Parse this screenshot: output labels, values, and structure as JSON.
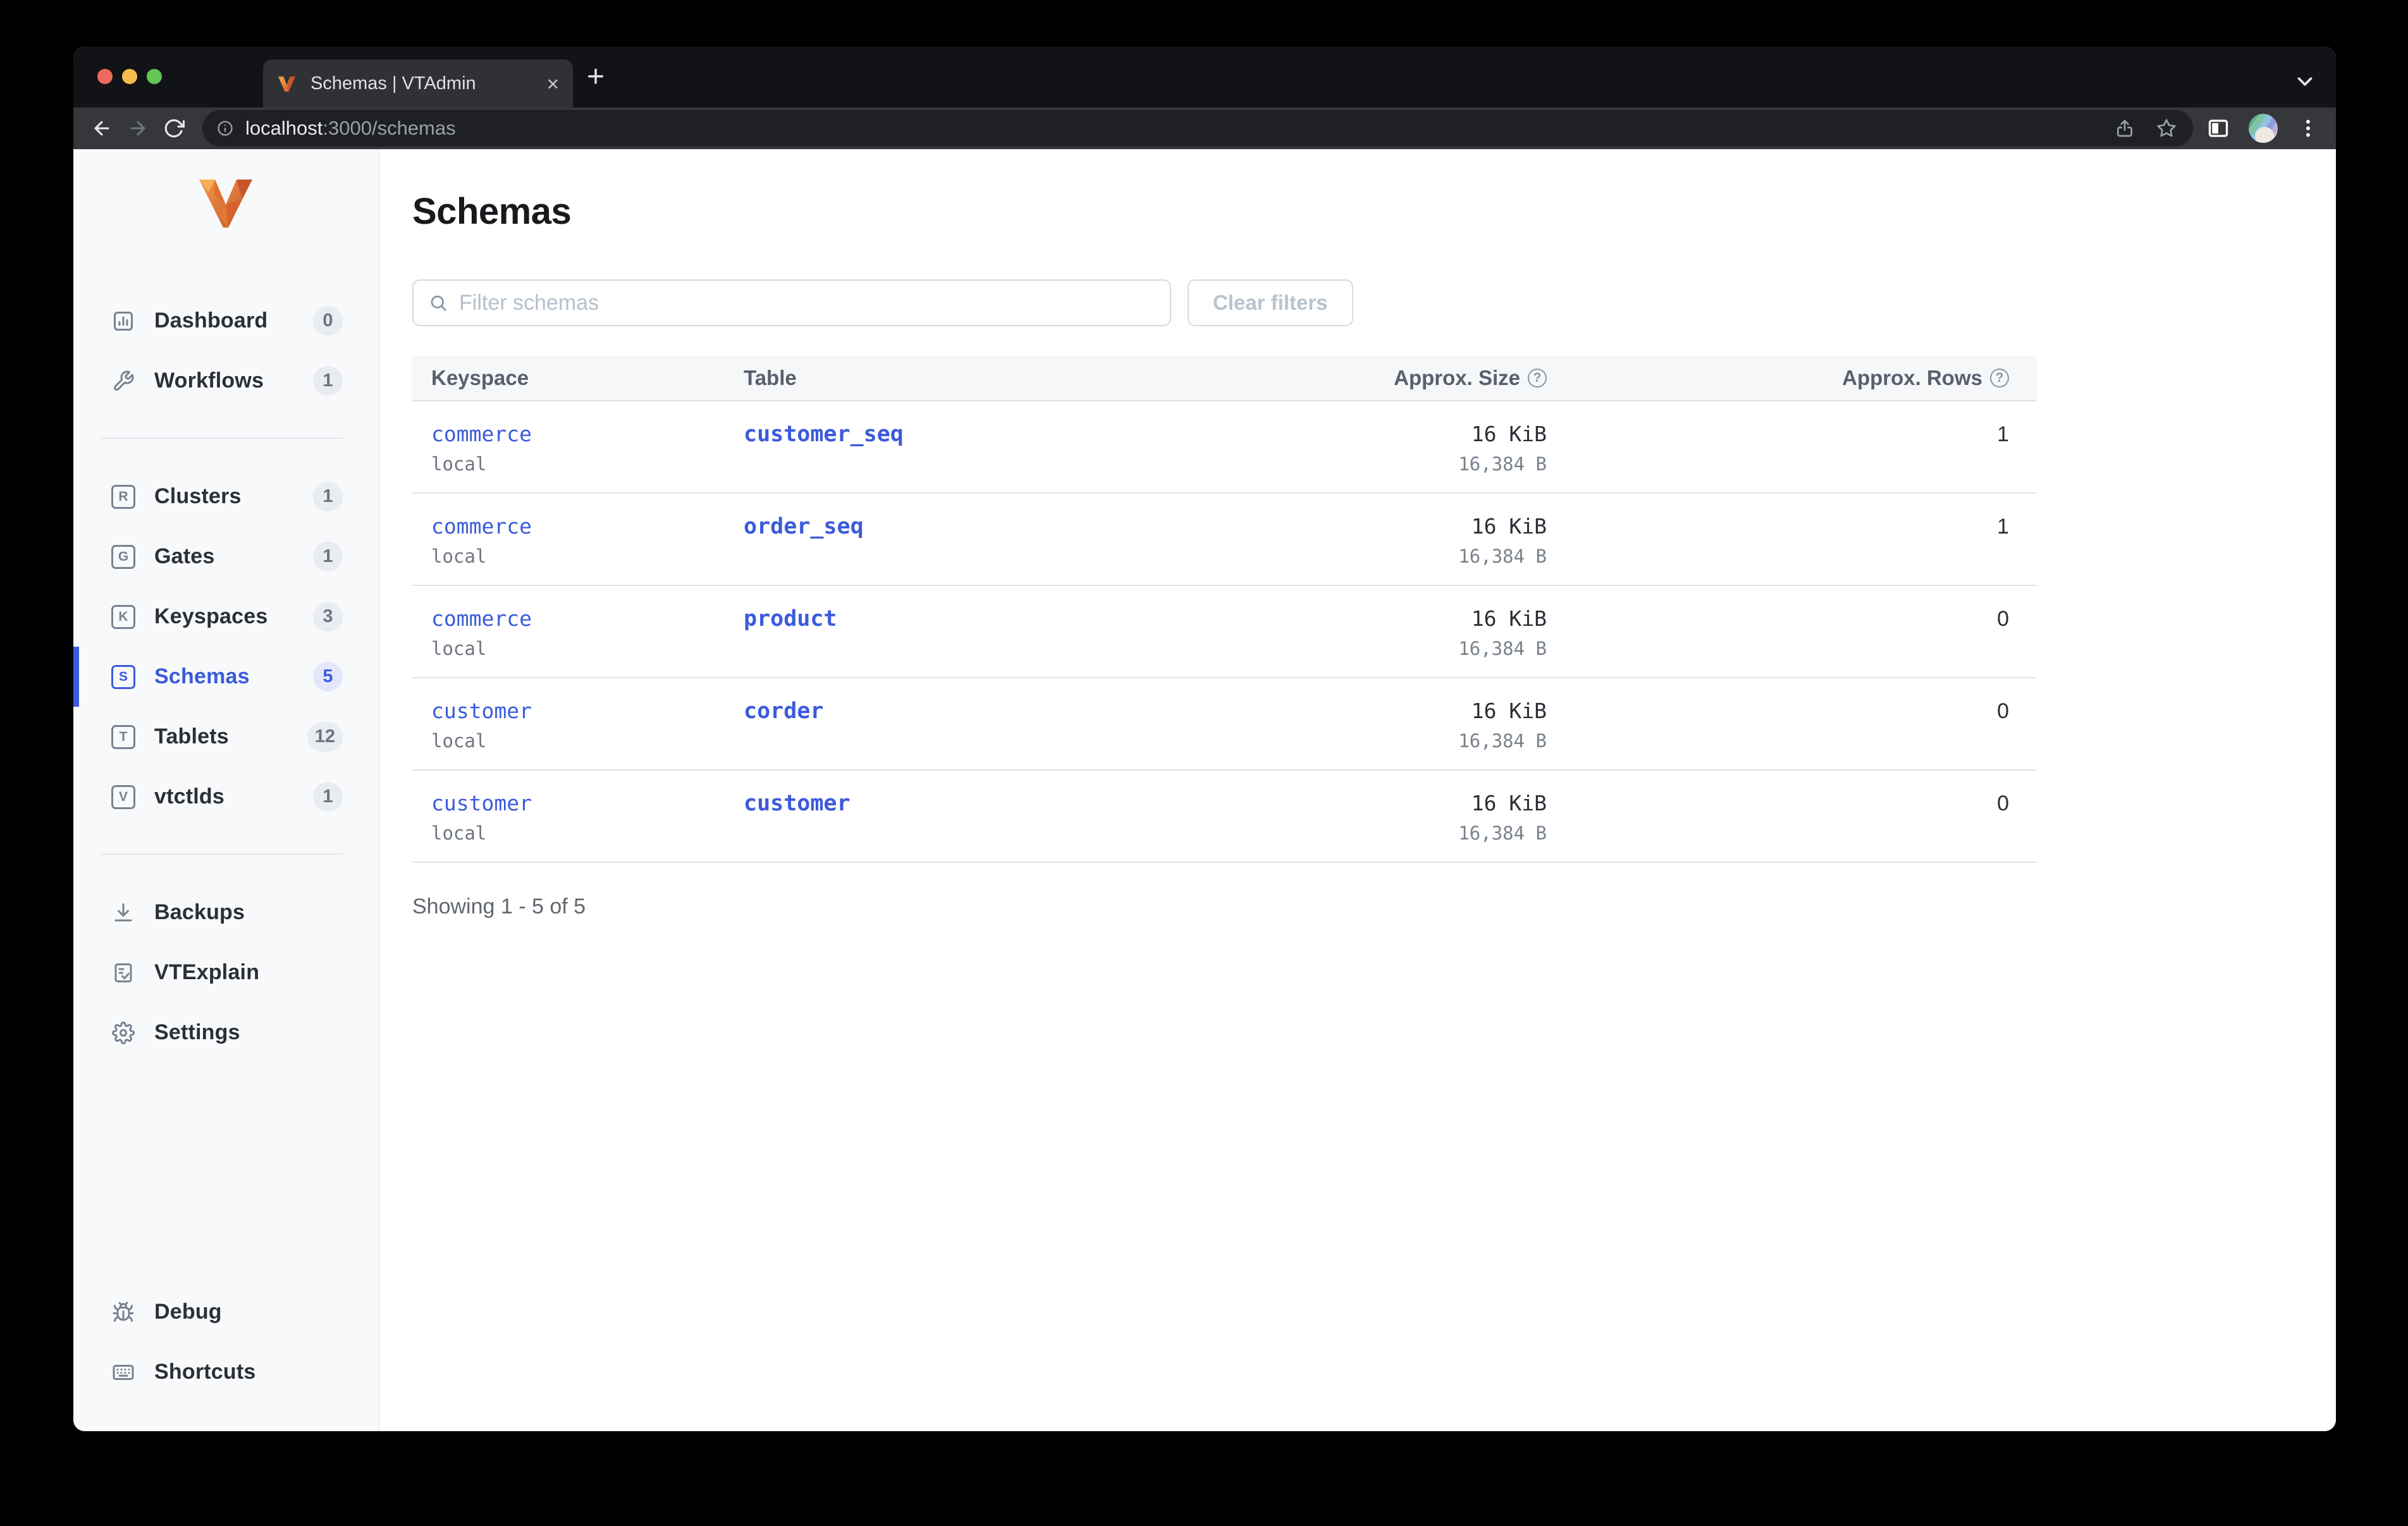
{
  "browser": {
    "tab": {
      "title": "Schemas | VTAdmin",
      "close_label": "×",
      "new_tab_label": "+"
    },
    "url": {
      "host": "localhost",
      "rest": ":3000/schemas"
    }
  },
  "colors": {
    "accent": "#3b5bdb",
    "link": "#3b5bdb",
    "traffic_red": "#ee6a5f",
    "traffic_yellow": "#f5bd4f",
    "traffic_green": "#62c554"
  },
  "sidebar": {
    "groups": [
      {
        "items": [
          {
            "icon": "dashboard",
            "label": "Dashboard",
            "count": "0"
          },
          {
            "icon": "wrench",
            "label": "Workflows",
            "count": "1"
          }
        ]
      },
      {
        "items": [
          {
            "icon": "letter:R",
            "label": "Clusters",
            "count": "1"
          },
          {
            "icon": "letter:G",
            "label": "Gates",
            "count": "1"
          },
          {
            "icon": "letter:K",
            "label": "Keyspaces",
            "count": "3"
          },
          {
            "icon": "letter:S",
            "label": "Schemas",
            "count": "5",
            "active": true
          },
          {
            "icon": "letter:T",
            "label": "Tablets",
            "count": "12"
          },
          {
            "icon": "letter:V",
            "label": "vtctlds",
            "count": "1"
          }
        ]
      },
      {
        "items": [
          {
            "icon": "download",
            "label": "Backups"
          },
          {
            "icon": "doccheck",
            "label": "VTExplain"
          },
          {
            "icon": "gear",
            "label": "Settings"
          }
        ]
      }
    ],
    "footer_items": [
      {
        "icon": "bug",
        "label": "Debug"
      },
      {
        "icon": "keyboard",
        "label": "Shortcuts"
      }
    ]
  },
  "main": {
    "title": "Schemas",
    "filter_placeholder": "Filter schemas",
    "clear_filters_label": "Clear filters",
    "table": {
      "columns": [
        "Keyspace",
        "Table",
        "Approx. Size",
        "Approx. Rows"
      ],
      "help_glyph": "?",
      "rows": [
        {
          "keyspace": "commerce",
          "cluster": "local",
          "table": "customer_seq",
          "size": "16 KiB",
          "size_bytes": "16,384 B",
          "rows": "1"
        },
        {
          "keyspace": "commerce",
          "cluster": "local",
          "table": "order_seq",
          "size": "16 KiB",
          "size_bytes": "16,384 B",
          "rows": "1"
        },
        {
          "keyspace": "commerce",
          "cluster": "local",
          "table": "product",
          "size": "16 KiB",
          "size_bytes": "16,384 B",
          "rows": "0"
        },
        {
          "keyspace": "customer",
          "cluster": "local",
          "table": "corder",
          "size": "16 KiB",
          "size_bytes": "16,384 B",
          "rows": "0"
        },
        {
          "keyspace": "customer",
          "cluster": "local",
          "table": "customer",
          "size": "16 KiB",
          "size_bytes": "16,384 B",
          "rows": "0"
        }
      ]
    },
    "summary": "Showing 1 - 5 of 5"
  }
}
